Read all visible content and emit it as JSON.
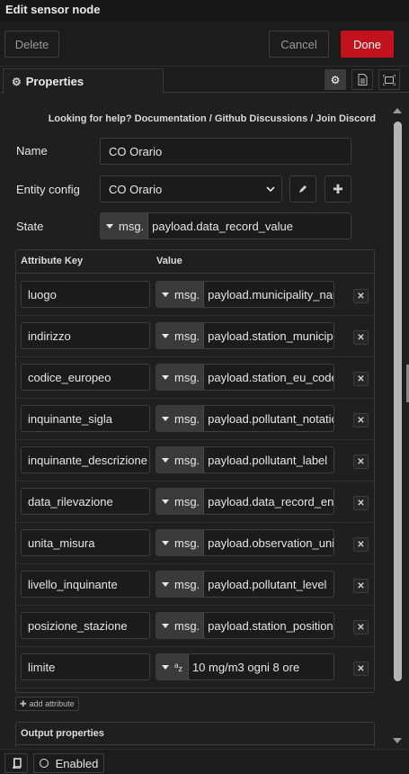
{
  "window": {
    "title": "Edit sensor node"
  },
  "actions": {
    "delete_label": "Delete",
    "cancel_label": "Cancel",
    "done_label": "Done"
  },
  "tabs": {
    "properties_label": "Properties",
    "icons": [
      "gear-icon",
      "document-icon",
      "frame-icon"
    ]
  },
  "help": {
    "prefix": "Looking for help?",
    "links": [
      "Documentation",
      "Github Discussions",
      "Join Discord"
    ],
    "separator": "/"
  },
  "form": {
    "name_label": "Name",
    "name_value": "CO Orario",
    "entity_label": "Entity config",
    "entity_value": "CO Orario",
    "state_label": "State",
    "state_type": "msg.",
    "state_value": "payload.data_record_value"
  },
  "attributes": {
    "header_key": "Attribute Key",
    "header_value": "Value",
    "rows": [
      {
        "key": "luogo",
        "type": "msg.",
        "value": "payload.municipality_name"
      },
      {
        "key": "indirizzo",
        "type": "msg.",
        "value": "payload.station_municipality"
      },
      {
        "key": "codice_europeo",
        "type": "msg.",
        "value": "payload.station_eu_code"
      },
      {
        "key": "inquinante_sigla",
        "type": "msg.",
        "value": "payload.pollutant_notation"
      },
      {
        "key": "inquinante_descrizione",
        "type": "msg.",
        "value": "payload.pollutant_label"
      },
      {
        "key": "data_rilevazione",
        "type": "msg.",
        "value": "payload.data_record_end_time"
      },
      {
        "key": "unita_misura",
        "type": "msg.",
        "value": "payload.observation_unit_of_measure"
      },
      {
        "key": "livello_inquinante",
        "type": "msg.",
        "value": "payload.pollutant_level"
      },
      {
        "key": "posizione_stazione",
        "type": "msg.",
        "value": "payload.station_position"
      },
      {
        "key": "limite",
        "type": "str",
        "value": "10 mg/m3 ogni 8 ore"
      }
    ],
    "add_label": "add attribute"
  },
  "output": {
    "label": "Output properties"
  },
  "footer": {
    "enabled_label": "Enabled"
  },
  "colors": {
    "done": "#c2121e",
    "background": "#1f1f1f",
    "border": "#3e3e3e"
  }
}
